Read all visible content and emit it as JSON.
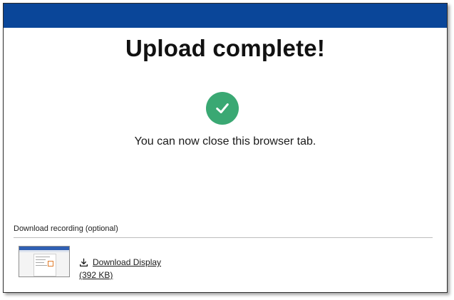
{
  "header": {
    "bar_color": "#0a4699"
  },
  "main": {
    "title": "Upload complete!",
    "status_icon": "check-circle-icon",
    "status_color": "#3aa873",
    "message": "You can now close this browser tab."
  },
  "download": {
    "section_label": "Download recording (optional)",
    "thumbnail_icon": "recording-thumbnail",
    "icon": "download-icon",
    "link_label": "Download Display",
    "size_label": "(392 KB)"
  }
}
